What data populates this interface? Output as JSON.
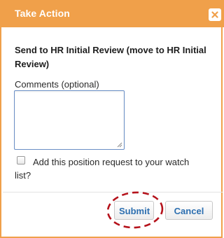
{
  "dialog": {
    "title": "Take Action",
    "close_icon": "close-icon"
  },
  "heading": "Send to HR Initial Review (move to HR Initial Review)",
  "comments": {
    "label": "Comments (optional)",
    "value": ""
  },
  "watch": {
    "label_line1": "Add this position request to your watch",
    "label_line2": "list?",
    "checked": false
  },
  "buttons": {
    "submit_label": "Submit",
    "cancel_label": "Cancel"
  },
  "colors": {
    "accent": "#f0a04a",
    "button_text": "#2d6fb0",
    "highlight": "#b5121b"
  }
}
